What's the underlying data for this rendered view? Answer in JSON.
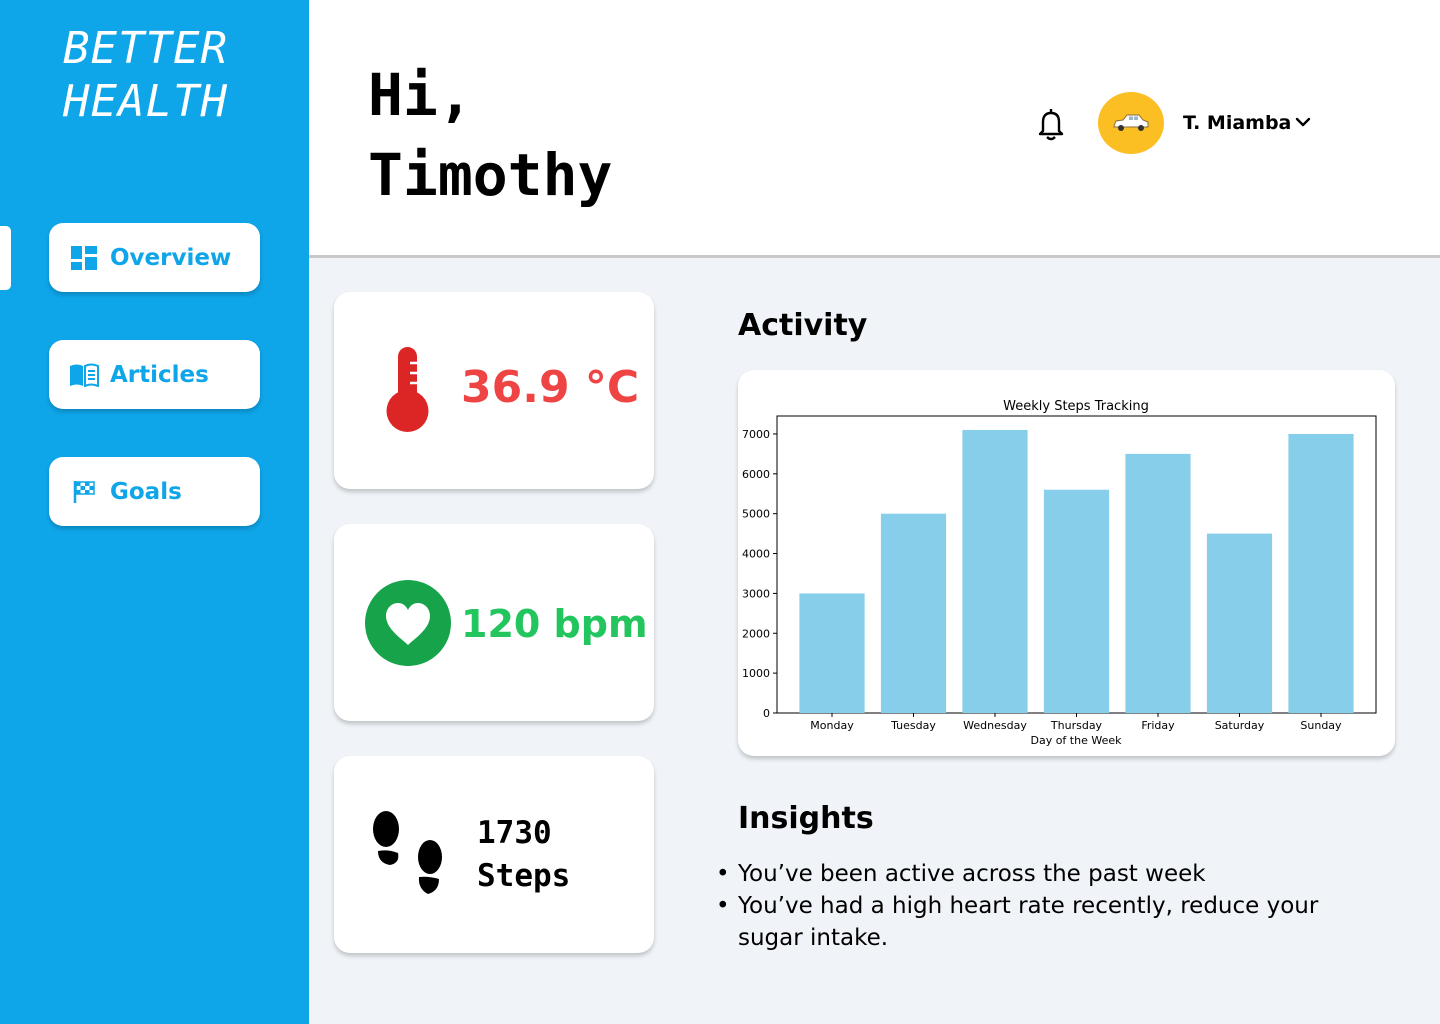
{
  "sidebar": {
    "logo": "BETTER\nHEALTH",
    "accent_color": "#0ea5e9",
    "nav": [
      {
        "label": "Overview",
        "icon": "dashboard-icon",
        "active": true
      },
      {
        "label": "Articles",
        "icon": "book-icon"
      },
      {
        "label": "Goals",
        "icon": "flag-icon"
      }
    ]
  },
  "header": {
    "greeting": "Hi,\nTimothy",
    "user_name": "T. Miamba",
    "icons": {
      "notifications": "bell-icon",
      "avatar": "car-avatar",
      "menu": "chevron-down-icon"
    }
  },
  "stats": {
    "temperature": {
      "value": "36.9 °C",
      "color": "#ef4444",
      "icon": "thermometer-icon"
    },
    "heart_rate": {
      "value": "120 bpm",
      "color": "#22c55e",
      "icon": "heart-icon"
    },
    "steps": {
      "value": "1730\nSteps",
      "icon": "footprints-icon"
    }
  },
  "activity": {
    "title": "Activity"
  },
  "chart_data": {
    "type": "bar",
    "title": "Weekly Steps Tracking",
    "xlabel": "Day of the Week",
    "ylabel": "",
    "categories": [
      "Monday",
      "Tuesday",
      "Wednesday",
      "Thursday",
      "Friday",
      "Saturday",
      "Sunday"
    ],
    "values": [
      3000,
      5000,
      7100,
      5600,
      6500,
      4500,
      7000
    ],
    "ylim": [
      0,
      7450
    ],
    "yticks": [
      0,
      1000,
      2000,
      3000,
      4000,
      5000,
      6000,
      7000
    ],
    "bar_color": "#87ceeb",
    "grid": false
  },
  "insights": {
    "title": "Insights",
    "items": [
      "You’ve been active across the past week",
      "You’ve had a high heart rate recently, reduce your sugar intake."
    ]
  }
}
